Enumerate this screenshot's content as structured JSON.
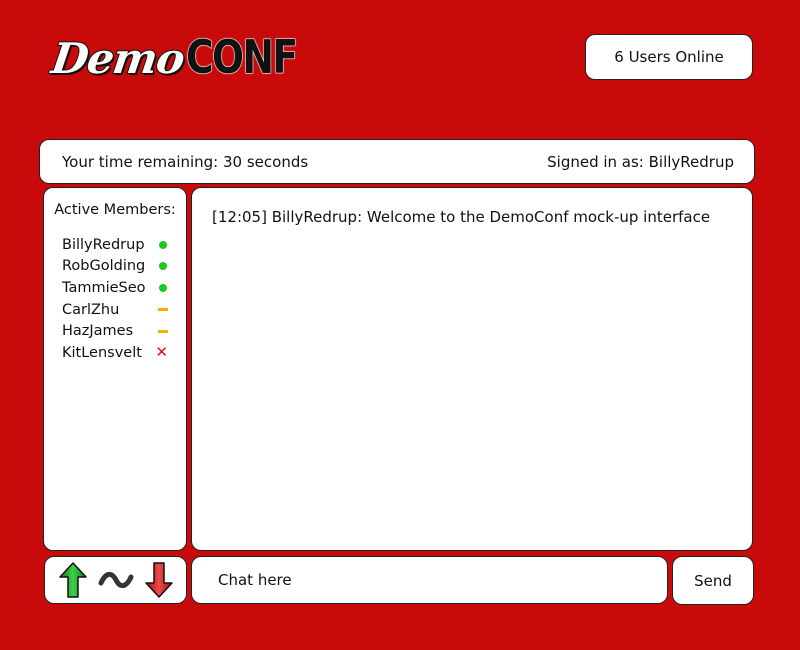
{
  "logo": {
    "part1": "Demo",
    "part2": "CONF"
  },
  "header": {
    "users_online": "6 Users Online"
  },
  "status": {
    "time_remaining": "Your time remaining: 30 seconds",
    "signed_in": "Signed in as: BillyRedrup"
  },
  "members": {
    "title": "Active Members:",
    "items": [
      {
        "name": "BillyRedrup",
        "status": "online"
      },
      {
        "name": "RobGolding",
        "status": "online"
      },
      {
        "name": "TammieSeo",
        "status": "online"
      },
      {
        "name": "CarlZhu",
        "status": "away"
      },
      {
        "name": "HazJames",
        "status": "away"
      },
      {
        "name": "KitLensvelt",
        "status": "offline"
      }
    ],
    "status_colors": {
      "online": "#1ec81e",
      "away": "#f0b400",
      "offline": "#e01010"
    }
  },
  "chat": {
    "messages": [
      "[12:05] BillyRedrup: Welcome to the DemoConf mock-up interface"
    ]
  },
  "controls": {
    "up_icon": "green-up-arrow-icon",
    "wave_icon": "tilde-wave-icon",
    "down_icon": "red-down-arrow-icon"
  },
  "input": {
    "placeholder": "Chat here"
  },
  "send": {
    "label": "Send"
  },
  "colors": {
    "background": "#c80a0a",
    "panel": "#ffffff"
  }
}
